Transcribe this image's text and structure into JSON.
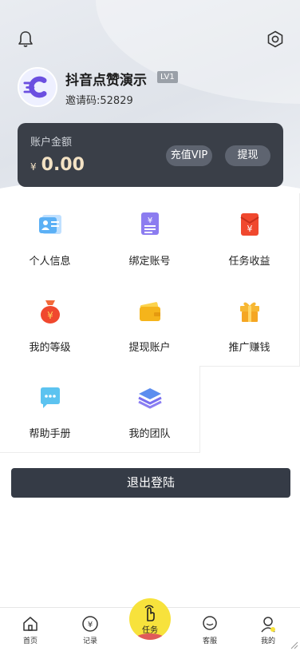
{
  "header": {
    "username": "抖音点赞演示",
    "level": "LV1",
    "invite_text": "邀请码:52829"
  },
  "account": {
    "label": "账户金额",
    "currency": "¥",
    "balance": "0.00",
    "recharge_label": "充值VIP",
    "withdraw_label": "提现"
  },
  "menu": [
    {
      "label": "个人信息",
      "icon": "id-card-icon"
    },
    {
      "label": "绑定账号",
      "icon": "bind-account-icon"
    },
    {
      "label": "任务收益",
      "icon": "red-envelope-icon"
    },
    {
      "label": "我的等级",
      "icon": "money-bag-icon"
    },
    {
      "label": "提现账户",
      "icon": "wallet-icon"
    },
    {
      "label": "推广赚钱",
      "icon": "gift-icon"
    },
    {
      "label": "帮助手册",
      "icon": "chat-bubble-icon"
    },
    {
      "label": "我的团队",
      "icon": "layers-icon"
    }
  ],
  "logout_label": "退出登陆",
  "tabbar": {
    "home": "首页",
    "records": "记录",
    "task": "任务",
    "service": "客服",
    "mine": "我的"
  },
  "colors": {
    "card_bg": "#3a3f48",
    "amount": "#f3e2c4",
    "task_button": "#f7e23c",
    "logout_bg": "#353b46"
  }
}
